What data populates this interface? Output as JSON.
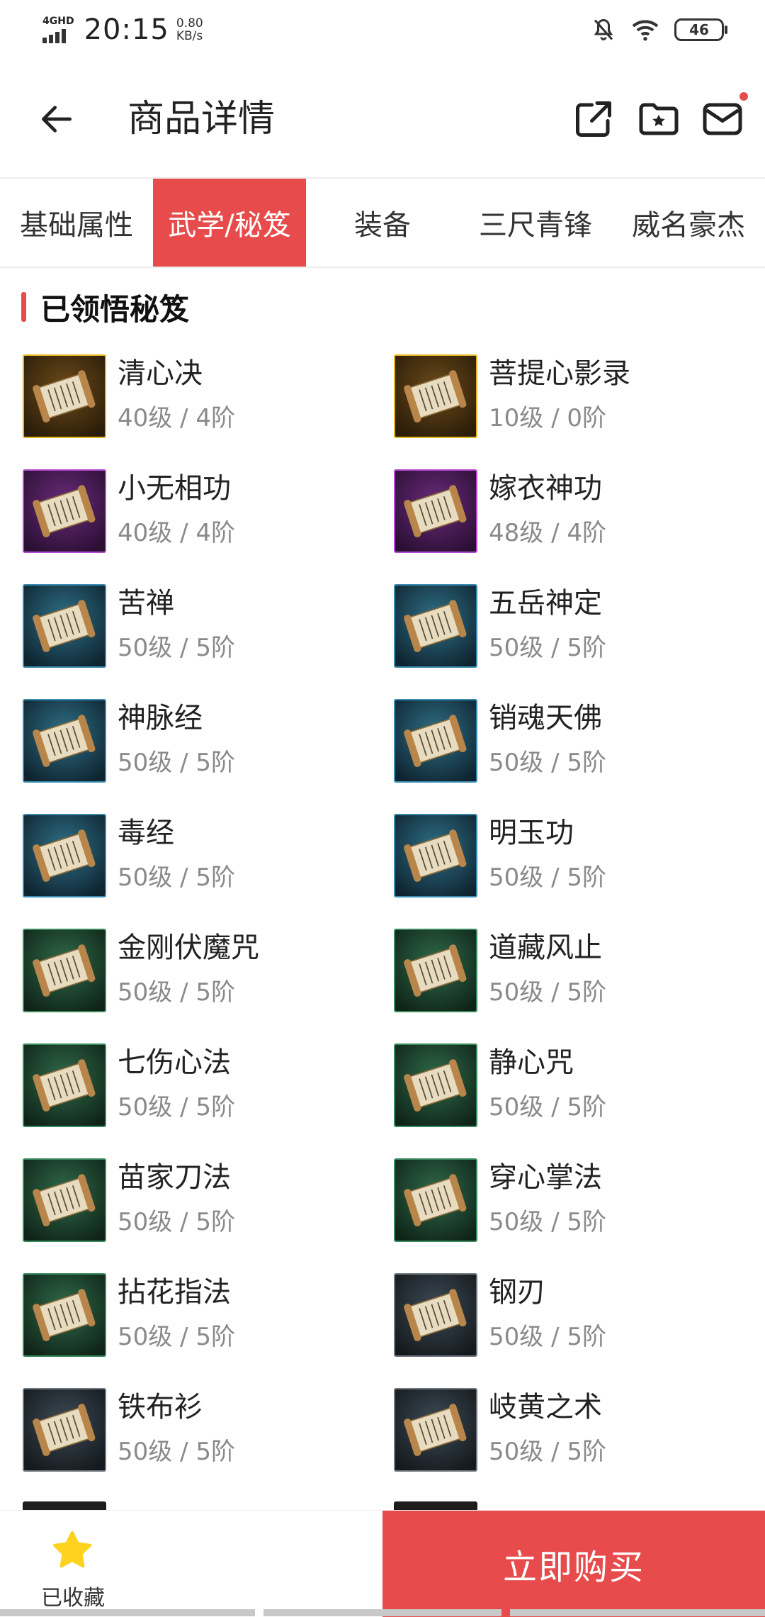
{
  "status_bar": {
    "network": "4GHD",
    "time": "20:15",
    "speed_value": "0.80",
    "speed_unit": "KB/s",
    "battery": "46",
    "icons": [
      "bell-off-icon",
      "wifi-icon",
      "battery-icon"
    ]
  },
  "header": {
    "title": "商品详情",
    "icons": [
      "back-arrow-icon",
      "share-icon",
      "favorite-folder-icon",
      "mail-icon"
    ],
    "notification_dot_color": "#e74b4b"
  },
  "tabs": [
    {
      "label": "基础属性",
      "active": false
    },
    {
      "label": "武学/秘笈",
      "active": true
    },
    {
      "label": "装备",
      "active": false
    },
    {
      "label": "三尺青锋",
      "active": false
    },
    {
      "label": "威名豪杰",
      "active": false
    }
  ],
  "section": {
    "title": "已领悟秘笈"
  },
  "skills": [
    {
      "name": "清心决",
      "level": "40级 / 4阶",
      "rarity": "gold"
    },
    {
      "name": "菩提心影录",
      "level": "10级 / 0阶",
      "rarity": "gold"
    },
    {
      "name": "小无相功",
      "level": "40级 / 4阶",
      "rarity": "purple"
    },
    {
      "name": "嫁衣神功",
      "level": "48级 / 4阶",
      "rarity": "purple"
    },
    {
      "name": "苦禅",
      "level": "50级 / 5阶",
      "rarity": "blue"
    },
    {
      "name": "五岳神定",
      "level": "50级 / 5阶",
      "rarity": "blue"
    },
    {
      "name": "神脉经",
      "level": "50级 / 5阶",
      "rarity": "blue"
    },
    {
      "name": "销魂天佛",
      "level": "50级 / 5阶",
      "rarity": "blue"
    },
    {
      "name": "毒经",
      "level": "50级 / 5阶",
      "rarity": "blue"
    },
    {
      "name": "明玉功",
      "level": "50级 / 5阶",
      "rarity": "blue"
    },
    {
      "name": "金刚伏魔咒",
      "level": "50级 / 5阶",
      "rarity": "green"
    },
    {
      "name": "道藏风止",
      "level": "50级 / 5阶",
      "rarity": "green"
    },
    {
      "name": "七伤心法",
      "level": "50级 / 5阶",
      "rarity": "green"
    },
    {
      "name": "静心咒",
      "level": "50级 / 5阶",
      "rarity": "green"
    },
    {
      "name": "苗家刀法",
      "level": "50级 / 5阶",
      "rarity": "green"
    },
    {
      "name": "穿心掌法",
      "level": "50级 / 5阶",
      "rarity": "green"
    },
    {
      "name": "拈花指法",
      "level": "50级 / 5阶",
      "rarity": "green"
    },
    {
      "name": "钢刃",
      "level": "50级 / 5阶",
      "rarity": "gray"
    },
    {
      "name": "铁布衫",
      "level": "50级 / 5阶",
      "rarity": "gray"
    },
    {
      "name": "岐黄之术",
      "level": "50级 / 5阶",
      "rarity": "gray"
    }
  ],
  "bottom": {
    "favorite_label": "已收藏",
    "buy_label": "立即购买",
    "accent_color": "#e74b4b",
    "star_color": "#ffd21f"
  }
}
